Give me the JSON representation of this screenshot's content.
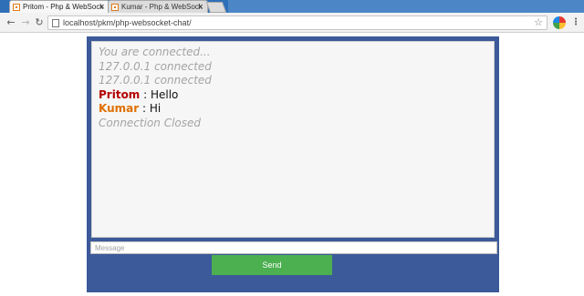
{
  "browser": {
    "tabs": [
      {
        "title": "Pritom - Php & WebSock",
        "active": true
      },
      {
        "title": "Kumar - Php & WebSock",
        "active": false
      }
    ],
    "url": "localhost/pkm/php-websocket-chat/"
  },
  "chat": {
    "messages": [
      {
        "kind": "system",
        "text": "You are connected..."
      },
      {
        "kind": "system",
        "text": "127.0.0.1 connected"
      },
      {
        "kind": "system",
        "text": "127.0.0.1 connected"
      },
      {
        "kind": "user",
        "user": "Pritom",
        "separator": " : ",
        "text": "Hello",
        "color": "#b30000"
      },
      {
        "kind": "user",
        "user": "Kumar",
        "separator": " : ",
        "text": "Hi",
        "color": "#e07000"
      },
      {
        "kind": "system",
        "text": "Connection Closed"
      }
    ],
    "input_placeholder": "Message",
    "send_label": "Send"
  },
  "colors": {
    "panel_bg": "#3c5a9a",
    "send_button": "#4caf50"
  },
  "icons": {
    "back": "back-arrow-icon",
    "forward": "forward-arrow-icon",
    "reload": "reload-icon",
    "bookmark": "star-icon",
    "extension": "extension-icon",
    "menu": "kebab-menu-icon"
  }
}
